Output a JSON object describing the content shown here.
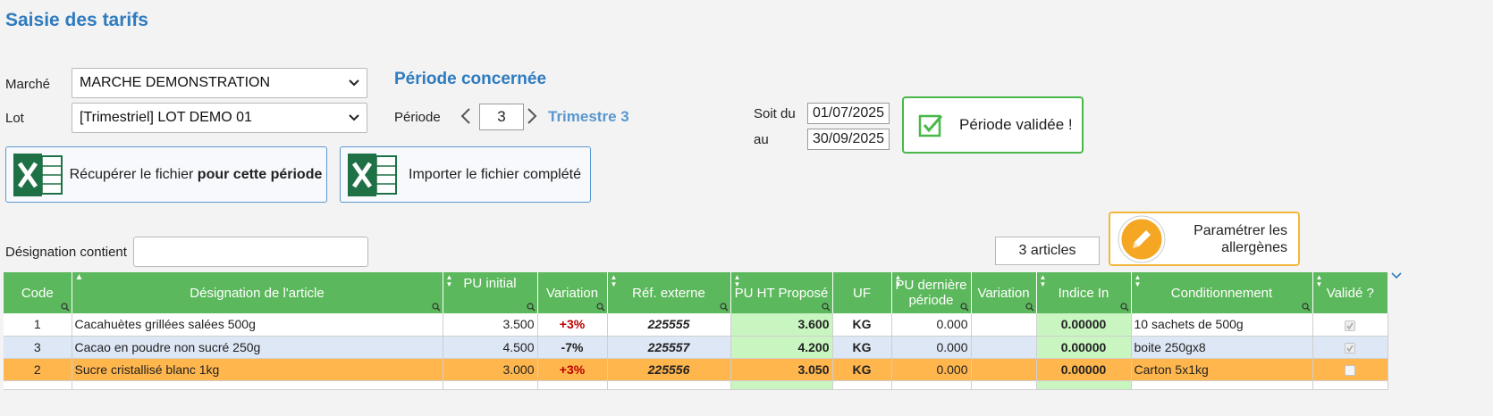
{
  "page": {
    "title": "Saisie des tarifs"
  },
  "filters": {
    "marche_label": "Marché",
    "marche_value": "MARCHE DEMONSTRATION",
    "lot_label": "Lot",
    "lot_value": "[Trimestriel] LOT DEMO 01"
  },
  "periode": {
    "section_title": "Période concernée",
    "label": "Période",
    "value": "3",
    "trimestre": "Trimestre 3",
    "soit_du_label": "Soit du",
    "date_from": "01/07/2025",
    "au_label": "au",
    "date_to": "30/09/2025",
    "validated_label": "Période validée !"
  },
  "actions": {
    "recuperer_prefix": "Récupérer le fichier ",
    "recuperer_bold": "pour cette période",
    "importer_label": "Importer le fichier complété",
    "allergenes_line1": "Paramétrer les",
    "allergenes_line2": "allergènes"
  },
  "search": {
    "designation_label": "Désignation contient",
    "designation_value": "",
    "articles_count": "3 articles"
  },
  "table": {
    "headers": [
      "Code",
      "Désignation de l'article",
      "PU initial",
      "Variation",
      "Réf. externe",
      "PU HT Proposé",
      "UF",
      "PU dernière période",
      "Variation",
      "Indice In",
      "Conditionnement",
      "Validé ?"
    ],
    "rows": [
      {
        "code": "1",
        "designation": "Cacahuètes grillées salées 500g",
        "pu_initial": "3.500",
        "variation": "+3%",
        "ref": "225555",
        "pu_ht": "3.600",
        "uf": "KG",
        "pu_derniere": "0.000",
        "variation2": "",
        "indice": "0.00000",
        "conditionnement": "10 sachets de 500g",
        "valide": true
      },
      {
        "code": "3",
        "designation": "Cacao en poudre non sucré 250g",
        "pu_initial": "4.500",
        "variation": "-7%",
        "ref": "225557",
        "pu_ht": "4.200",
        "uf": "KG",
        "pu_derniere": "0.000",
        "variation2": "",
        "indice": "0.00000",
        "conditionnement": "boite 250gx8",
        "valide": true
      },
      {
        "code": "2",
        "designation": "Sucre cristallisé blanc 1kg",
        "pu_initial": "3.000",
        "variation": "+3%",
        "ref": "225556",
        "pu_ht": "3.050",
        "uf": "KG",
        "pu_derniere": "0.000",
        "variation2": "",
        "indice": "0.00000",
        "conditionnement": "Carton 5x1kg",
        "valide": false
      }
    ]
  },
  "colors": {
    "accent": "#2f7bbf",
    "header_green": "#5cb85c",
    "validated_green": "#49b749",
    "highlight_orange": "#ffb64d",
    "selected_blue": "#dde7f5"
  },
  "icons": [
    "chevron-down-icon",
    "chevron-left-icon",
    "chevron-right-icon",
    "excel-icon",
    "check-icon",
    "pencil-icon",
    "sort-icon",
    "filter-icon"
  ]
}
